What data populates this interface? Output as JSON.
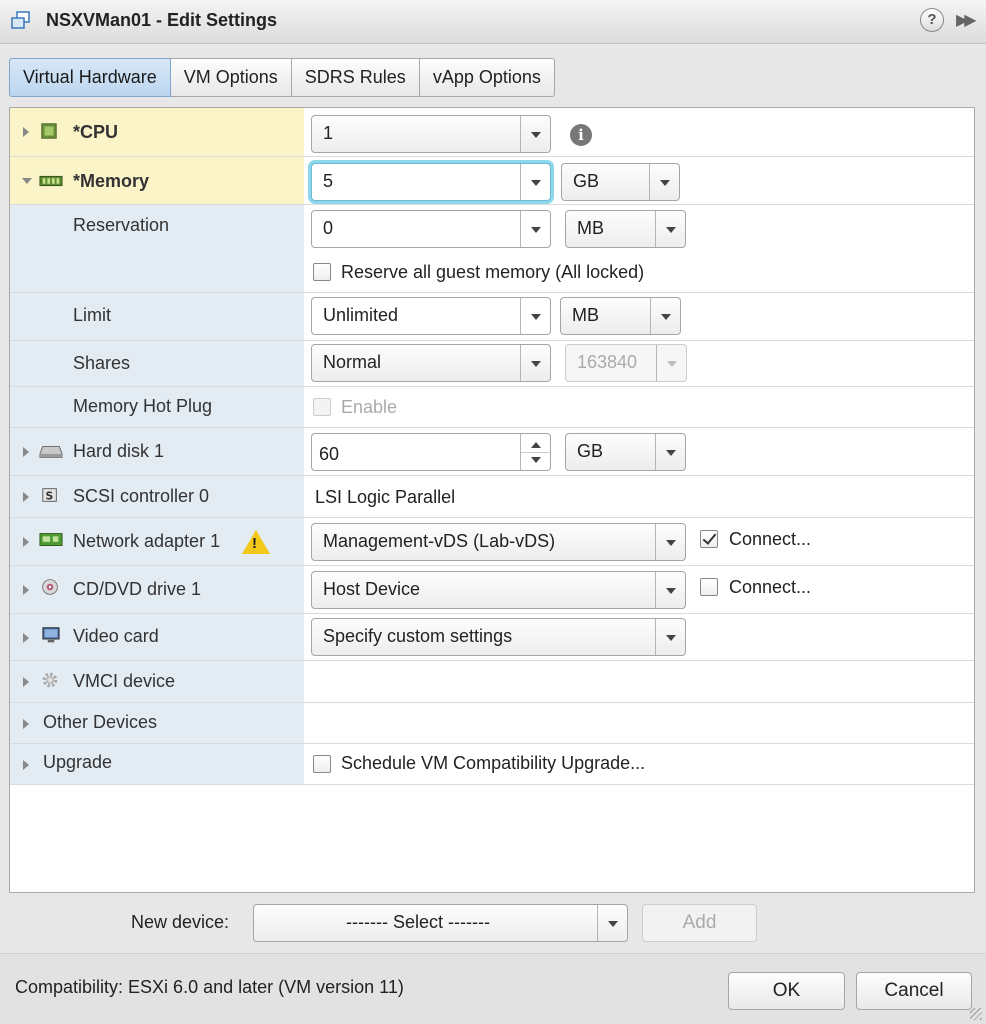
{
  "window": {
    "title": "NSXVMan01 - Edit Settings",
    "help": "?",
    "expand": "▶▶"
  },
  "tabs": [
    "Virtual Hardware",
    "VM Options",
    "SDRS Rules",
    "vApp Options"
  ],
  "hardware": {
    "cpu": {
      "label": "*CPU",
      "value": "1"
    },
    "memory": {
      "label": "*Memory",
      "value": "5",
      "unit": "GB"
    },
    "reservation": {
      "label": "Reservation",
      "value": "0",
      "unit": "MB",
      "reserve_all": "Reserve all guest memory (All locked)"
    },
    "limit": {
      "label": "Limit",
      "value": "Unlimited",
      "unit": "MB"
    },
    "shares": {
      "label": "Shares",
      "value": "Normal",
      "amount": "163840"
    },
    "hotplug": {
      "label": "Memory Hot Plug",
      "enable": "Enable"
    },
    "harddisk": {
      "label": "Hard disk 1",
      "value": "60",
      "unit": "GB"
    },
    "scsi": {
      "label": "SCSI controller 0",
      "value": "LSI Logic Parallel"
    },
    "network": {
      "label": "Network adapter 1",
      "value": "Management-vDS (Lab-vDS)",
      "connect": "Connect..."
    },
    "cddvd": {
      "label": "CD/DVD drive 1",
      "value": "Host Device",
      "connect": "Connect..."
    },
    "video": {
      "label": "Video card",
      "value": "Specify custom settings"
    },
    "vmci": {
      "label": "VMCI device"
    },
    "other": {
      "label": "Other Devices"
    },
    "upgrade": {
      "label": "Upgrade",
      "schedule": "Schedule VM Compatibility Upgrade..."
    }
  },
  "new_device": {
    "label": "New device:",
    "select": "------- Select -------",
    "add": "Add"
  },
  "footer": {
    "compatibility": "Compatibility: ESXi 6.0 and later (VM version 11)",
    "ok": "OK",
    "cancel": "Cancel"
  }
}
